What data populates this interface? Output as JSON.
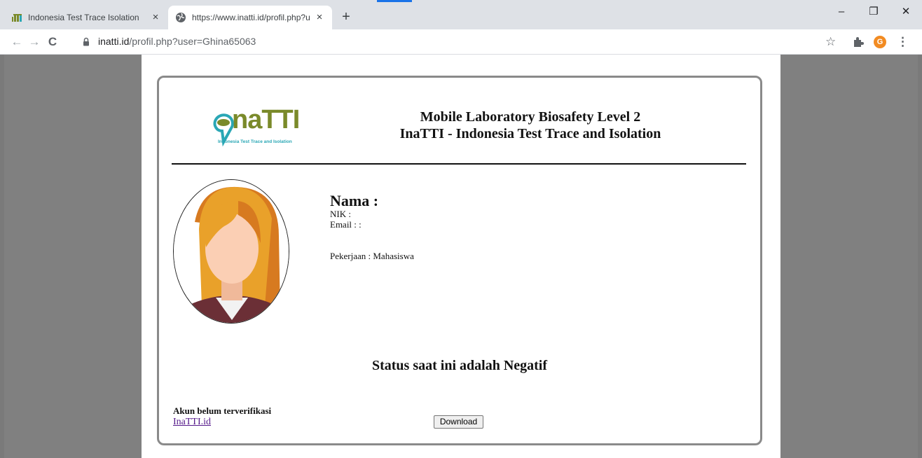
{
  "browser": {
    "tabs": [
      {
        "title": "Indonesia Test Trace Isolation",
        "active": false
      },
      {
        "title": "https://www.inatti.id/profil.php?u",
        "active": true
      }
    ],
    "new_tab_symbol": "+",
    "close_symbol": "×",
    "url_domain": "inatti.id",
    "url_path": "/profil.php?user=Ghina65063",
    "profile_initial": "G",
    "window_controls": {
      "minimize": "–",
      "maximize": "❐",
      "close": "✕"
    },
    "icons": [
      "back-arrow-icon",
      "forward-arrow-icon",
      "reload-icon",
      "lock-icon",
      "star-icon",
      "puzzle-extension-icon",
      "more-menu-icon"
    ]
  },
  "page": {
    "logo": {
      "text": "naTTI",
      "subtitle": "Indonesia Test Trace and Isolation",
      "color": "#7a8a2a",
      "accent": "#2aa7b5"
    },
    "heading_line1": "Mobile Laboratory Biosafety Level 2",
    "heading_line2": "InaTTI - Indonesia Test Trace and Isolation",
    "profile": {
      "nama_label": "Nama :",
      "nik_label": "NIK :",
      "email_label": "Email : :",
      "pekerjaan": "Pekerjaan : Mahasiswa"
    },
    "status_text": "Status saat ini adalah Negatif",
    "verification_text": "Akun belum terverifikasi",
    "link_text": "InaTTI.id",
    "download_label": "Download"
  }
}
